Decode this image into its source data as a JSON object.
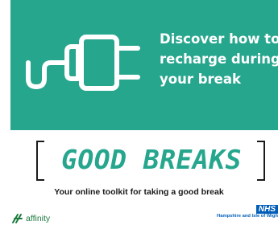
{
  "banner": {
    "line1": "Discover how to",
    "line2": "recharge during",
    "line3": "your break",
    "background_color": "#27a68e",
    "icon": "plug-icon"
  },
  "brand": {
    "title": "GOOD BREAKS",
    "title_color": "#27a68e"
  },
  "tagline": "Your online toolkit for taking a good break",
  "footer": {
    "affinity_label": "affinity",
    "nhs_logo": "NHS",
    "nhs_org": "Hampshire and Isle of Wigh"
  }
}
